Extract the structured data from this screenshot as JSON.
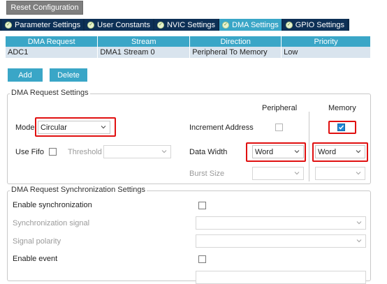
{
  "reset_button": "Reset Configuration",
  "tabs": [
    {
      "label": "Parameter Settings",
      "active": false
    },
    {
      "label": "User Constants",
      "active": false
    },
    {
      "label": "NVIC Settings",
      "active": false
    },
    {
      "label": "DMA Settings",
      "active": true
    },
    {
      "label": "GPIO Settings",
      "active": false
    }
  ],
  "table": {
    "headers": [
      "DMA Request",
      "Stream",
      "Direction",
      "Priority"
    ],
    "rows": [
      [
        "ADC1",
        "DMA1 Stream 0",
        "Peripheral To Memory",
        "Low"
      ]
    ]
  },
  "buttons": {
    "add": "Add",
    "delete": "Delete"
  },
  "request_settings": {
    "title": "DMA Request Settings",
    "peripheral_header": "Peripheral",
    "memory_header": "Memory",
    "mode_label": "Mode",
    "mode_value": "Circular",
    "increment_label": "Increment Address",
    "increment_peripheral": false,
    "increment_memory": true,
    "use_fifo_label": "Use Fifo",
    "threshold_label": "Threshold",
    "threshold_value": "",
    "data_width_label": "Data Width",
    "data_width_peripheral": "Word",
    "data_width_memory": "Word",
    "burst_size_label": "Burst Size",
    "burst_peripheral": "",
    "burst_memory": ""
  },
  "sync_settings": {
    "title": "DMA Request Synchronization Settings",
    "enable_sync_label": "Enable synchronization",
    "sync_signal_label": "Synchronization signal",
    "signal_polarity_label": "Signal polarity",
    "enable_event_label": "Enable event",
    "sync_signal_value": "",
    "signal_polarity_value": ""
  },
  "colors": {
    "tab_bar": "#0b2a4a",
    "accent": "#3aa6c7",
    "row_bg": "#d9e4ee",
    "highlight": "#e01010",
    "check": "#1e88d6"
  }
}
